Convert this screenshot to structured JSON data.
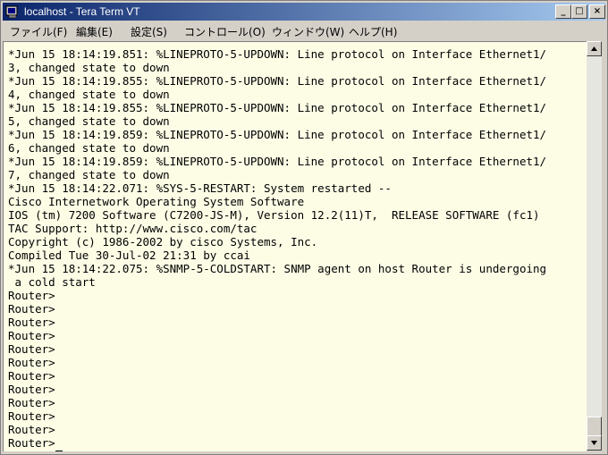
{
  "window": {
    "title": "localhost - Tera Term VT"
  },
  "title_buttons": {
    "minimize": "_",
    "maximize": "□",
    "close": "×"
  },
  "menu": [
    "ファイル(F)",
    "編集(E)",
    "設定(S)",
    "コントロール(O)",
    "ウィンドウ(W)",
    "ヘルプ(H)"
  ],
  "terminal": {
    "lines": [
      "*Jun 15 18:14:19.851: %LINEPROTO-5-UPDOWN: Line protocol on Interface Ethernet1/",
      "3, changed state to down",
      "*Jun 15 18:14:19.855: %LINEPROTO-5-UPDOWN: Line protocol on Interface Ethernet1/",
      "4, changed state to down",
      "*Jun 15 18:14:19.855: %LINEPROTO-5-UPDOWN: Line protocol on Interface Ethernet1/",
      "5, changed state to down",
      "*Jun 15 18:14:19.859: %LINEPROTO-5-UPDOWN: Line protocol on Interface Ethernet1/",
      "6, changed state to down",
      "*Jun 15 18:14:19.859: %LINEPROTO-5-UPDOWN: Line protocol on Interface Ethernet1/",
      "7, changed state to down",
      "*Jun 15 18:14:22.071: %SYS-5-RESTART: System restarted --",
      "Cisco Internetwork Operating System Software",
      "IOS (tm) 7200 Software (C7200-JS-M), Version 12.2(11)T,  RELEASE SOFTWARE (fc1)",
      "TAC Support: http://www.cisco.com/tac",
      "Copyright (c) 1986-2002 by cisco Systems, Inc.",
      "Compiled Tue 30-Jul-02 21:31 by ccai",
      "*Jun 15 18:14:22.075: %SNMP-5-COLDSTART: SNMP agent on host Router is undergoing",
      " a cold start",
      "Router>",
      "Router>",
      "Router>",
      "Router>",
      "Router>",
      "Router>",
      "Router>",
      "Router>",
      "Router>",
      "Router>",
      "Router>",
      "Router>",
      "Router>"
    ]
  }
}
